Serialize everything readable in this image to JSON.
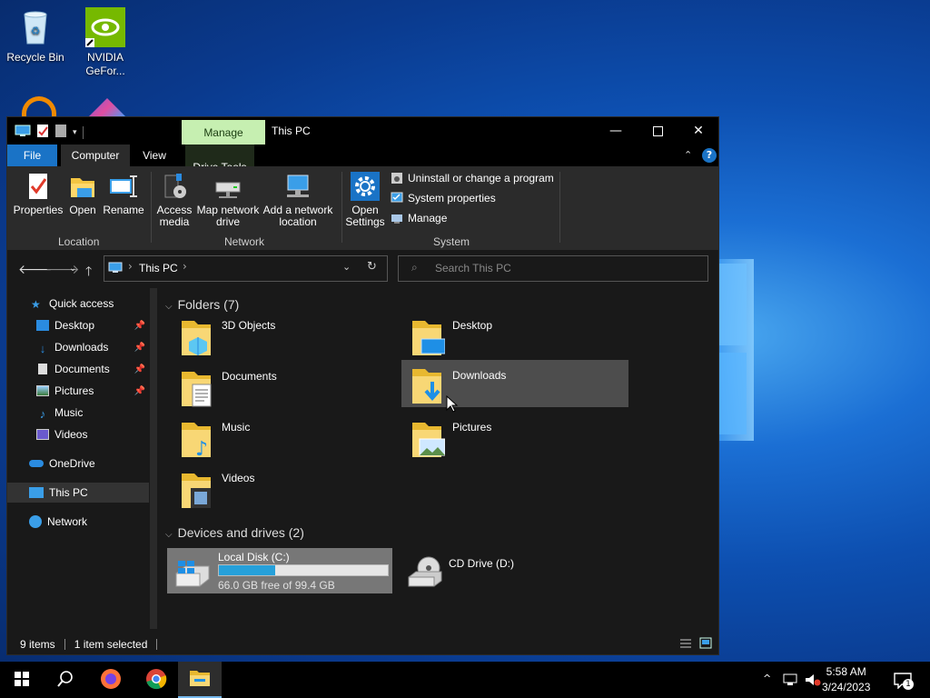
{
  "desktop": {
    "icons": [
      {
        "label": "Recycle Bin"
      },
      {
        "label": "NVIDIA GeFor..."
      }
    ]
  },
  "window": {
    "title": "This PC",
    "context_tab": "Manage",
    "tabs": {
      "file": "File",
      "computer": "Computer",
      "view": "View",
      "drive_tools": "Drive Tools"
    },
    "ribbon": {
      "location": {
        "label": "Location",
        "properties": "Properties",
        "open": "Open",
        "rename": "Rename"
      },
      "network": {
        "label": "Network",
        "access_media": "Access media",
        "map_network_drive": "Map network drive",
        "add_network_location": "Add a network location"
      },
      "system": {
        "label": "System",
        "open_settings": "Open Settings",
        "uninstall": "Uninstall or change a program",
        "system_properties": "System properties",
        "manage": "Manage"
      }
    },
    "address": {
      "path": "This PC",
      "search_placeholder": "Search This PC"
    },
    "sidebar": {
      "quick_access": "Quick access",
      "items": [
        {
          "label": "Desktop",
          "pinned": true
        },
        {
          "label": "Downloads",
          "pinned": true
        },
        {
          "label": "Documents",
          "pinned": true
        },
        {
          "label": "Pictures",
          "pinned": true
        },
        {
          "label": "Music",
          "pinned": false
        },
        {
          "label": "Videos",
          "pinned": false
        }
      ],
      "onedrive": "OneDrive",
      "this_pc": "This PC",
      "network": "Network"
    },
    "folders": {
      "header": "Folders (7)",
      "items": [
        "3D Objects",
        "Desktop",
        "Documents",
        "Downloads",
        "Music",
        "Pictures",
        "Videos"
      ]
    },
    "drives": {
      "header": "Devices and drives (2)",
      "local": {
        "name": "Local Disk (C:)",
        "free_text": "66.0 GB free of 99.4 GB",
        "used_fraction": 0.336
      },
      "cd": {
        "name": "CD Drive (D:)"
      }
    },
    "status": {
      "items": "9 items",
      "selected": "1 item selected"
    }
  },
  "taskbar": {
    "time": "5:58 AM",
    "date": "3/24/2023",
    "notification_count": "1"
  },
  "colors": {
    "accent": "#1a73c6",
    "manage_tab": "#c6efb1",
    "progress": "#26a0da"
  }
}
